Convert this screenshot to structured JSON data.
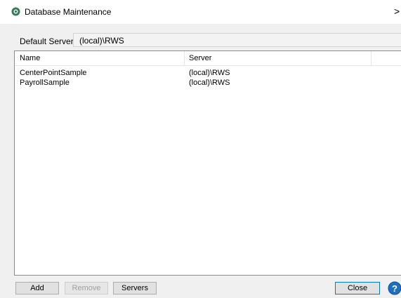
{
  "window": {
    "title": "Database Maintenance",
    "close_glyph": ">"
  },
  "default_server": {
    "label": "Default Server",
    "value": "(local)\\RWS"
  },
  "list": {
    "columns": [
      "Name",
      "Server",
      ""
    ],
    "rows": [
      {
        "name": "CenterPointSample",
        "server": "(local)\\RWS"
      },
      {
        "name": "PayrollSample",
        "server": "(local)\\RWS"
      }
    ]
  },
  "buttons": {
    "add": "Add",
    "remove": "Remove",
    "servers": "Servers",
    "close": "Close"
  },
  "colors": {
    "app_icon": "#2f7d5b",
    "help_icon": "#1e6fc1",
    "default_button_border": "#0078d7"
  },
  "icons": {
    "app": "app-logo-icon",
    "help": "help-icon"
  }
}
